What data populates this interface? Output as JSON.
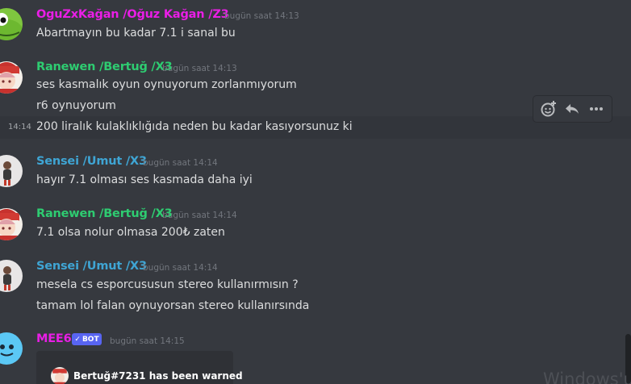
{
  "messages": [
    {
      "username": "OguZxKağan /Oğuz Kağan /Z3",
      "color": "#e91ee6",
      "timestamp": "bugün saat 14:13",
      "avatar": "frog-avatar",
      "lines": [
        "Abartmayın bu kadar 7.1 i sanal bu"
      ]
    },
    {
      "username": "Ranewen /Bertuğ /X3",
      "color": "#2ecc71",
      "timestamp": "bugün saat 14:13",
      "avatar": "anime-avatar",
      "lines": [
        "ses kasmalık oyun oynuyorum zorlanmıyorum",
        "r6 oynuyorum",
        "200 liralık kulaklıklığıda neden bu kadar kasıyorsunuz ki"
      ]
    },
    {
      "username": "Sensei /Umut /X3",
      "color": "#3fa5d4",
      "timestamp": "bugün saat 14:14",
      "avatar": "person-avatar",
      "lines": [
        "hayır 7.1 olması ses kasmada daha iyi"
      ]
    },
    {
      "username": "Ranewen /Bertuğ /X3",
      "color": "#2ecc71",
      "timestamp": "bugün saat 14:14",
      "avatar": "anime-avatar",
      "lines": [
        "7.1 olsa nolur olmasa 200₺ zaten"
      ]
    },
    {
      "username": "Sensei /Umut /X3",
      "color": "#3fa5d4",
      "timestamp": "bugün saat 14:14",
      "avatar": "person-avatar",
      "lines": [
        "mesela cs esporcususun stereo kullanırmısın ?",
        "tamam lol falan oynuyorsan stereo kullanırsında"
      ]
    },
    {
      "username": "MEE6",
      "color": "#e91ee6",
      "timestamp": "bugün saat 14:15",
      "avatar": "mee6-avatar",
      "bot_tag": "BOT",
      "embed_author": "Bertuğ#7231 has been warned"
    }
  ],
  "hover": {
    "side_timestamp": "14:14",
    "toolbar": {
      "add_reaction": "add-reaction-icon",
      "reply": "reply-icon",
      "more": "more-icon"
    }
  },
  "watermark": "Windows'u E"
}
